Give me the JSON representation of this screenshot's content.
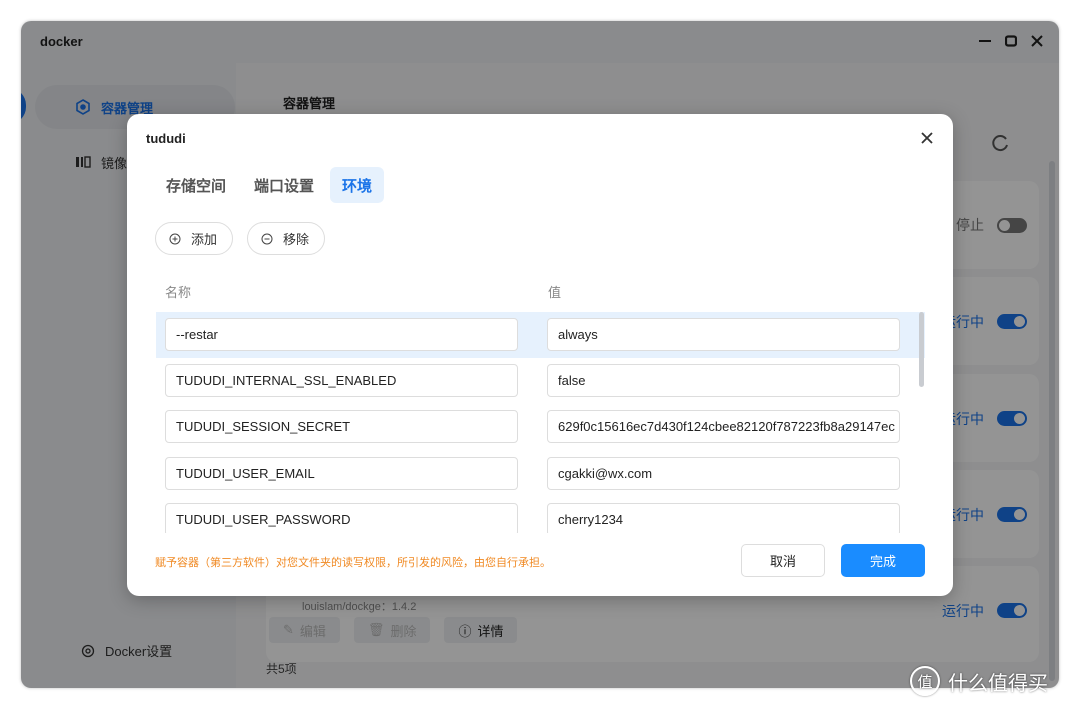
{
  "window": {
    "title": "docker",
    "controls": [
      "minimize",
      "maximize",
      "close"
    ]
  },
  "sidebar": {
    "items": [
      {
        "label": "容器管理",
        "icon": "container-icon",
        "active": true
      },
      {
        "label": "镜像",
        "icon": "image-icon",
        "active": false
      }
    ],
    "footer": {
      "label": "Docker设置",
      "icon": "gear-icon"
    }
  },
  "main": {
    "title": "容器管理",
    "refresh_icon": "refresh-icon",
    "cards": [
      {
        "status": "停止",
        "enabled": false
      },
      {
        "status": "运行中",
        "enabled": true
      },
      {
        "status": "运行中",
        "enabled": true
      },
      {
        "status": "运行中",
        "enabled": true
      },
      {
        "status": "运行中",
        "enabled": true,
        "image": "louislam/dockge：1.4.2",
        "buttons": [
          "编辑",
          "删除",
          "详情"
        ]
      }
    ],
    "total": "共5项"
  },
  "modal": {
    "title": "tududi",
    "tabs": [
      {
        "label": "存储空间",
        "active": false
      },
      {
        "label": "端口设置",
        "active": false
      },
      {
        "label": "环境",
        "active": true
      }
    ],
    "actions": {
      "add": "添加",
      "remove": "移除"
    },
    "columns": {
      "name": "名称",
      "value": "值"
    },
    "env": [
      {
        "name": "--restar",
        "value": "always",
        "selected": true
      },
      {
        "name": "TUDUDI_INTERNAL_SSL_ENABLED",
        "value": "false",
        "selected": false
      },
      {
        "name": "TUDUDI_SESSION_SECRET",
        "value": "629f0c15616ec7d430f124cbee82120f787223fb8a29147ec",
        "selected": false
      },
      {
        "name": "TUDUDI_USER_EMAIL",
        "value": "cgakki@wx.com",
        "selected": false
      },
      {
        "name": "TUDUDI_USER_PASSWORD",
        "value": "cherry1234",
        "selected": false
      }
    ],
    "warning": "赋予容器（第三方软件）对您文件夹的读写权限，所引发的风险，由您自行承担。",
    "cancel": "取消",
    "confirm": "完成"
  },
  "watermark": {
    "text": "什么值得买",
    "logo": "值"
  },
  "colors": {
    "accent": "#1a73e8",
    "primary_button": "#1a8cff",
    "warning": "#f08a24"
  }
}
